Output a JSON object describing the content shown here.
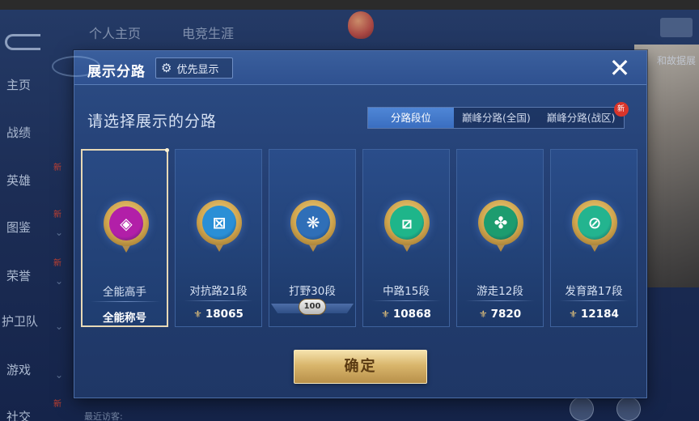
{
  "background": {
    "top_tabs": [
      "个人主页",
      "电竞生涯"
    ],
    "sidebar_items": [
      {
        "label": "主页",
        "new": false
      },
      {
        "label": "战绩",
        "new": false
      },
      {
        "label": "英雄",
        "new": true
      },
      {
        "label": "图鉴",
        "new": true
      },
      {
        "label": "荣誉",
        "new": true
      },
      {
        "label": "护卫队",
        "new": false
      },
      {
        "label": "游戏",
        "new": false
      },
      {
        "label": "社交",
        "new": true
      }
    ],
    "new_badge": "新",
    "right_text": "和故据展",
    "visitors_label": "最近访客:"
  },
  "modal": {
    "title": "展示分路",
    "priority_label": "优先显示",
    "subtitle": "请选择展示的分路",
    "tabs": [
      {
        "label": "分路段位",
        "active": true
      },
      {
        "label": "巅峰分路(全国)",
        "active": false
      },
      {
        "label": "巅峰分路(战区)",
        "active": false,
        "badge": "新"
      }
    ],
    "cards": [
      {
        "name": "全能高手",
        "score": "全能称号",
        "selected": true,
        "badge_color": "#b21fa8",
        "badge_glyph": "◈"
      },
      {
        "name": "对抗路21段",
        "score": "18065",
        "selected": false,
        "badge_color": "#2a8fd6",
        "badge_glyph": "⊠"
      },
      {
        "name": "打野30段",
        "score": "",
        "jungle_medal": "100",
        "selected": false,
        "badge_color": "#2f6fb8",
        "badge_glyph": "❋"
      },
      {
        "name": "中路15段",
        "score": "10868",
        "selected": false,
        "badge_color": "#1eb58a",
        "badge_glyph": "⧄"
      },
      {
        "name": "游走12段",
        "score": "7820",
        "selected": false,
        "badge_color": "#1d9c6f",
        "badge_glyph": "✤"
      },
      {
        "name": "发育路17段",
        "score": "12184",
        "selected": false,
        "badge_color": "#23b48f",
        "badge_glyph": "⊘"
      }
    ],
    "confirm_label": "确定"
  }
}
